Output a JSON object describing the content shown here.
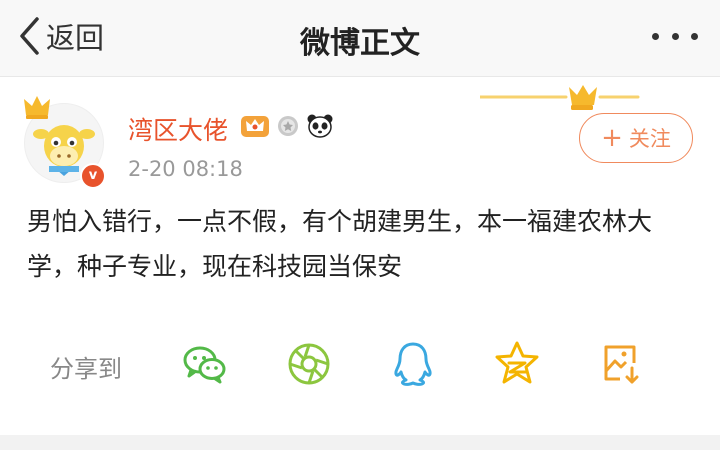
{
  "nav": {
    "back_label": "返回",
    "title": "微博正文"
  },
  "post": {
    "username": "湾区大佬",
    "timestamp": "2-20 08:18",
    "follow_label": "关注",
    "verified_mark": "v",
    "text": "男怕入错行，一点不假，有个胡建男生，本一福建农林大学，种子专业，现在科技园当保安"
  },
  "share": {
    "label": "分享到",
    "targets": [
      "wechat-icon",
      "moments-icon",
      "qq-icon",
      "qzone-icon",
      "save-image-icon"
    ]
  },
  "colors": {
    "username": "#e8532c",
    "follow": "#f08a5d",
    "wechat": "#53b948",
    "moments": "#8cc63f",
    "qq": "#3aa8e0",
    "qzone": "#f4b400",
    "save": "#f0a12b"
  }
}
